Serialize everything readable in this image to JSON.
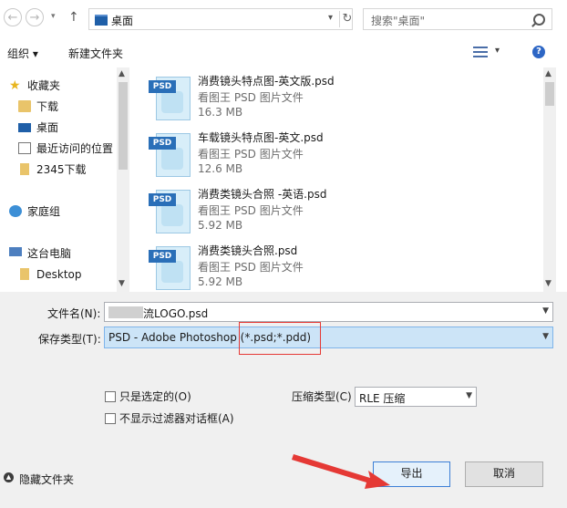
{
  "address_bar": {
    "location": "桌面",
    "search_placeholder": "搜索\"桌面\""
  },
  "toolbar": {
    "organize_label": "组织 ▾",
    "new_folder_label": "新建文件夹",
    "view_dropdown": "▾",
    "help": "?"
  },
  "nav_pane": {
    "items": [
      {
        "label": "收藏夹",
        "icon": "star-icon"
      },
      {
        "label": "下载",
        "icon": "download-folder-icon"
      },
      {
        "label": "桌面",
        "icon": "desktop-icon"
      },
      {
        "label": "最近访问的位置",
        "icon": "recent-places-icon"
      },
      {
        "label": "2345下载",
        "icon": "folder-icon"
      },
      {
        "label": "家庭组",
        "icon": "homegroup-icon"
      },
      {
        "label": "这台电脑",
        "icon": "computer-icon"
      },
      {
        "label": "Desktop",
        "icon": "folder-icon"
      }
    ]
  },
  "files": [
    {
      "name": "消费镜头特点图-英文版.psd",
      "type": "看图王 PSD 图片文件",
      "size": "16.3 MB",
      "icon_tag": "PSD"
    },
    {
      "name": "车载镜头特点图-英文.psd",
      "type": "看图王 PSD 图片文件",
      "size": "12.6 MB",
      "icon_tag": "PSD"
    },
    {
      "name": "消费类镜头合照 -英语.psd",
      "type": "看图王 PSD 图片文件",
      "size": "5.92 MB",
      "icon_tag": "PSD"
    },
    {
      "name": "消费类镜头合照.psd",
      "type": "看图王 PSD 图片文件",
      "size": "5.92 MB",
      "icon_tag": "PSD"
    }
  ],
  "form": {
    "filename_label": "文件名(N):",
    "filename_value": "流LOGO.psd",
    "filetype_label": "保存类型(T):",
    "filetype_value": "PSD - Adobe Photoshop (*.psd;*.pdd)",
    "only_selected_label": "只是选定的(O)",
    "no_filter_dialog_label": "不显示过滤器对话框(A)",
    "compression_label": "压缩类型(C)",
    "compression_value": "RLE 压缩"
  },
  "footer": {
    "hide_folders_label": "隐藏文件夹",
    "export_button": "导出",
    "cancel_button": "取消"
  },
  "colors": {
    "annotation_red": "#e53935",
    "selection_blue": "#cce4f7",
    "accent": "#2d66c5"
  }
}
